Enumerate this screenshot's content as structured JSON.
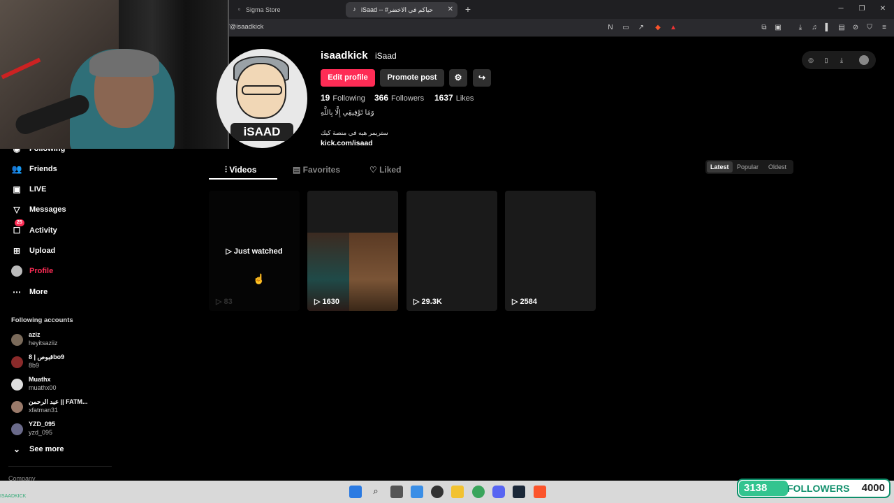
{
  "browser": {
    "tabs": [
      {
        "title": "Sigma Store"
      },
      {
        "title": "iSaad -- #حياكم في الاخضر"
      }
    ],
    "url": "/@isaadkick"
  },
  "sidebar": {
    "items": [
      {
        "label": "Following",
        "icon": "following-icon"
      },
      {
        "label": "Friends",
        "icon": "friends-icon"
      },
      {
        "label": "LIVE",
        "icon": "live-icon"
      },
      {
        "label": "Messages",
        "icon": "messages-icon"
      },
      {
        "label": "Activity",
        "icon": "activity-icon",
        "badge": "25"
      },
      {
        "label": "Upload",
        "icon": "upload-icon"
      },
      {
        "label": "Profile",
        "icon": "profile-avatar"
      },
      {
        "label": "More",
        "icon": "more-icon"
      }
    ],
    "following_title": "Following accounts",
    "accounts": [
      {
        "name": "aziz",
        "handle": "heyitsaziiz"
      },
      {
        "name": "قبوص | 8bo9",
        "handle": "8b9"
      },
      {
        "name": "Muathx",
        "handle": "muathx00"
      },
      {
        "name": "عبد الرحمن || FATM...",
        "handle": "xfatman31"
      },
      {
        "name": "YZD_095",
        "handle": "yzd_095"
      }
    ],
    "see_more": "See more",
    "company": "Company"
  },
  "profile": {
    "username": "isaadkick",
    "nickname": "iSaad",
    "avatar_text": "iSAAD",
    "edit_label": "Edit profile",
    "promote_label": "Promote post",
    "stats": [
      {
        "value": "19",
        "label": "Following"
      },
      {
        "value": "366",
        "label": "Followers"
      },
      {
        "value": "1637",
        "label": "Likes"
      }
    ],
    "bio_line1": "وَمَا تَوْفِيقِي إِلَّا بِاللَّهِ",
    "bio_line2": "ستريمر هيه في منصة كيك",
    "link": "kick.com/isaad"
  },
  "tabs": [
    {
      "label": "Videos"
    },
    {
      "label": "Favorites"
    },
    {
      "label": "Liked"
    }
  ],
  "sort": [
    "Latest",
    "Popular",
    "Oldest"
  ],
  "videos": [
    {
      "views": "83",
      "overlay": "Just watched"
    },
    {
      "views": "1630"
    },
    {
      "views": "29.3K"
    },
    {
      "views": "2584"
    }
  ],
  "overlay": {
    "followers_count": "3138",
    "followers_label": "FOLLOWERS",
    "goal": "4000"
  },
  "taskbar": {
    "left_text": "ISAADKICK"
  },
  "colors": {
    "accent": "#fe2c55",
    "goal_green": "#33c48f"
  }
}
